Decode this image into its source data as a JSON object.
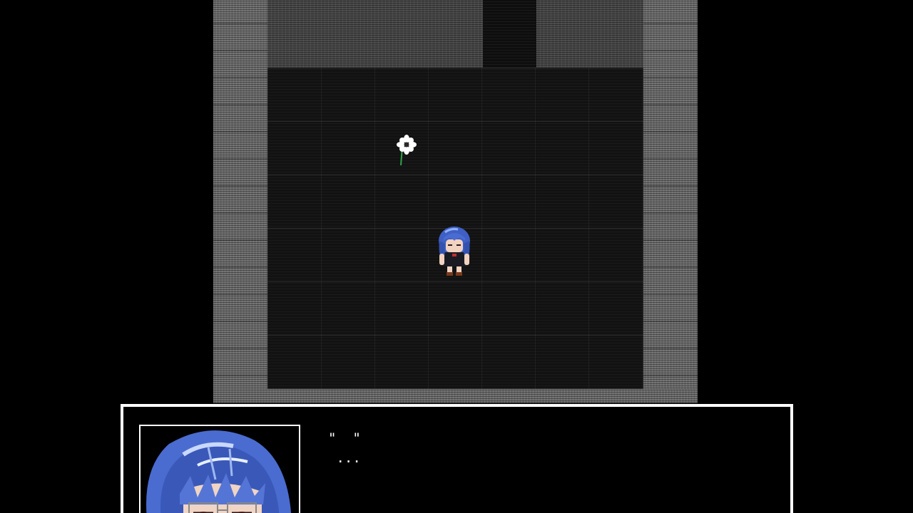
{
  "scene": {
    "location": "stone-room",
    "objects": [
      {
        "kind": "flower",
        "icon": "flower-icon"
      },
      {
        "kind": "player",
        "icon": "player-sprite-icon"
      }
    ]
  },
  "dialog": {
    "speaker_portrait": "blue-haired-girl-portrait",
    "line1": "\"  \"",
    "line2": " ..."
  },
  "colors": {
    "window_border": "#ffffff",
    "window_background": "#000000",
    "text": "#ffffff",
    "hair": "#4a6cd0"
  }
}
